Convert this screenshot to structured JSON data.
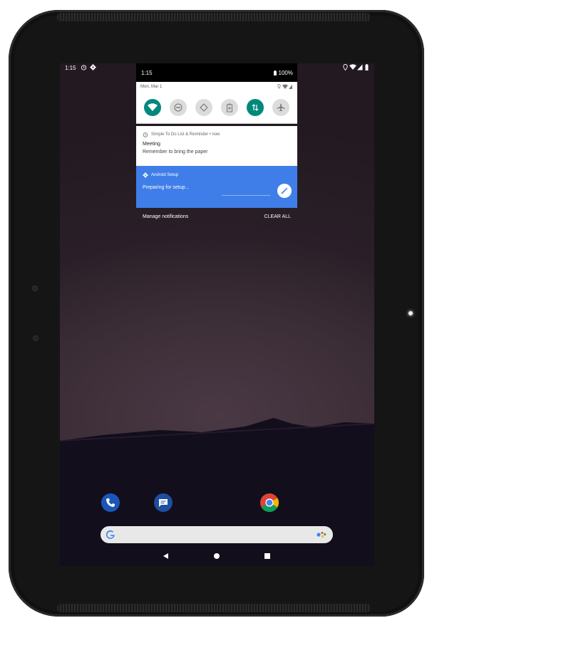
{
  "status_bar": {
    "time": "1:15"
  },
  "panel": {
    "time": "1:15",
    "battery": "100%",
    "date": "Mon, Mar 1",
    "tiles": [
      {
        "name": "wifi-icon",
        "on": true
      },
      {
        "name": "dnd-icon",
        "on": false
      },
      {
        "name": "auto-rotate-icon",
        "on": false
      },
      {
        "name": "battery-saver-icon",
        "on": false
      },
      {
        "name": "mobile-data-icon",
        "on": true
      },
      {
        "name": "airplane-icon",
        "on": false
      }
    ]
  },
  "notification_todo": {
    "app": "Simple To Do List & Reminder • now",
    "title": "Meeting",
    "text": "Remember to bring the paper"
  },
  "notification_setup": {
    "app": "Android Setup",
    "text": "Preparing for setup..."
  },
  "footer": {
    "manage": "Manage notifications",
    "clear": "CLEAR ALL"
  },
  "colors": {
    "accent_teal": "#00897b",
    "setup_blue": "#3f7ee8"
  }
}
